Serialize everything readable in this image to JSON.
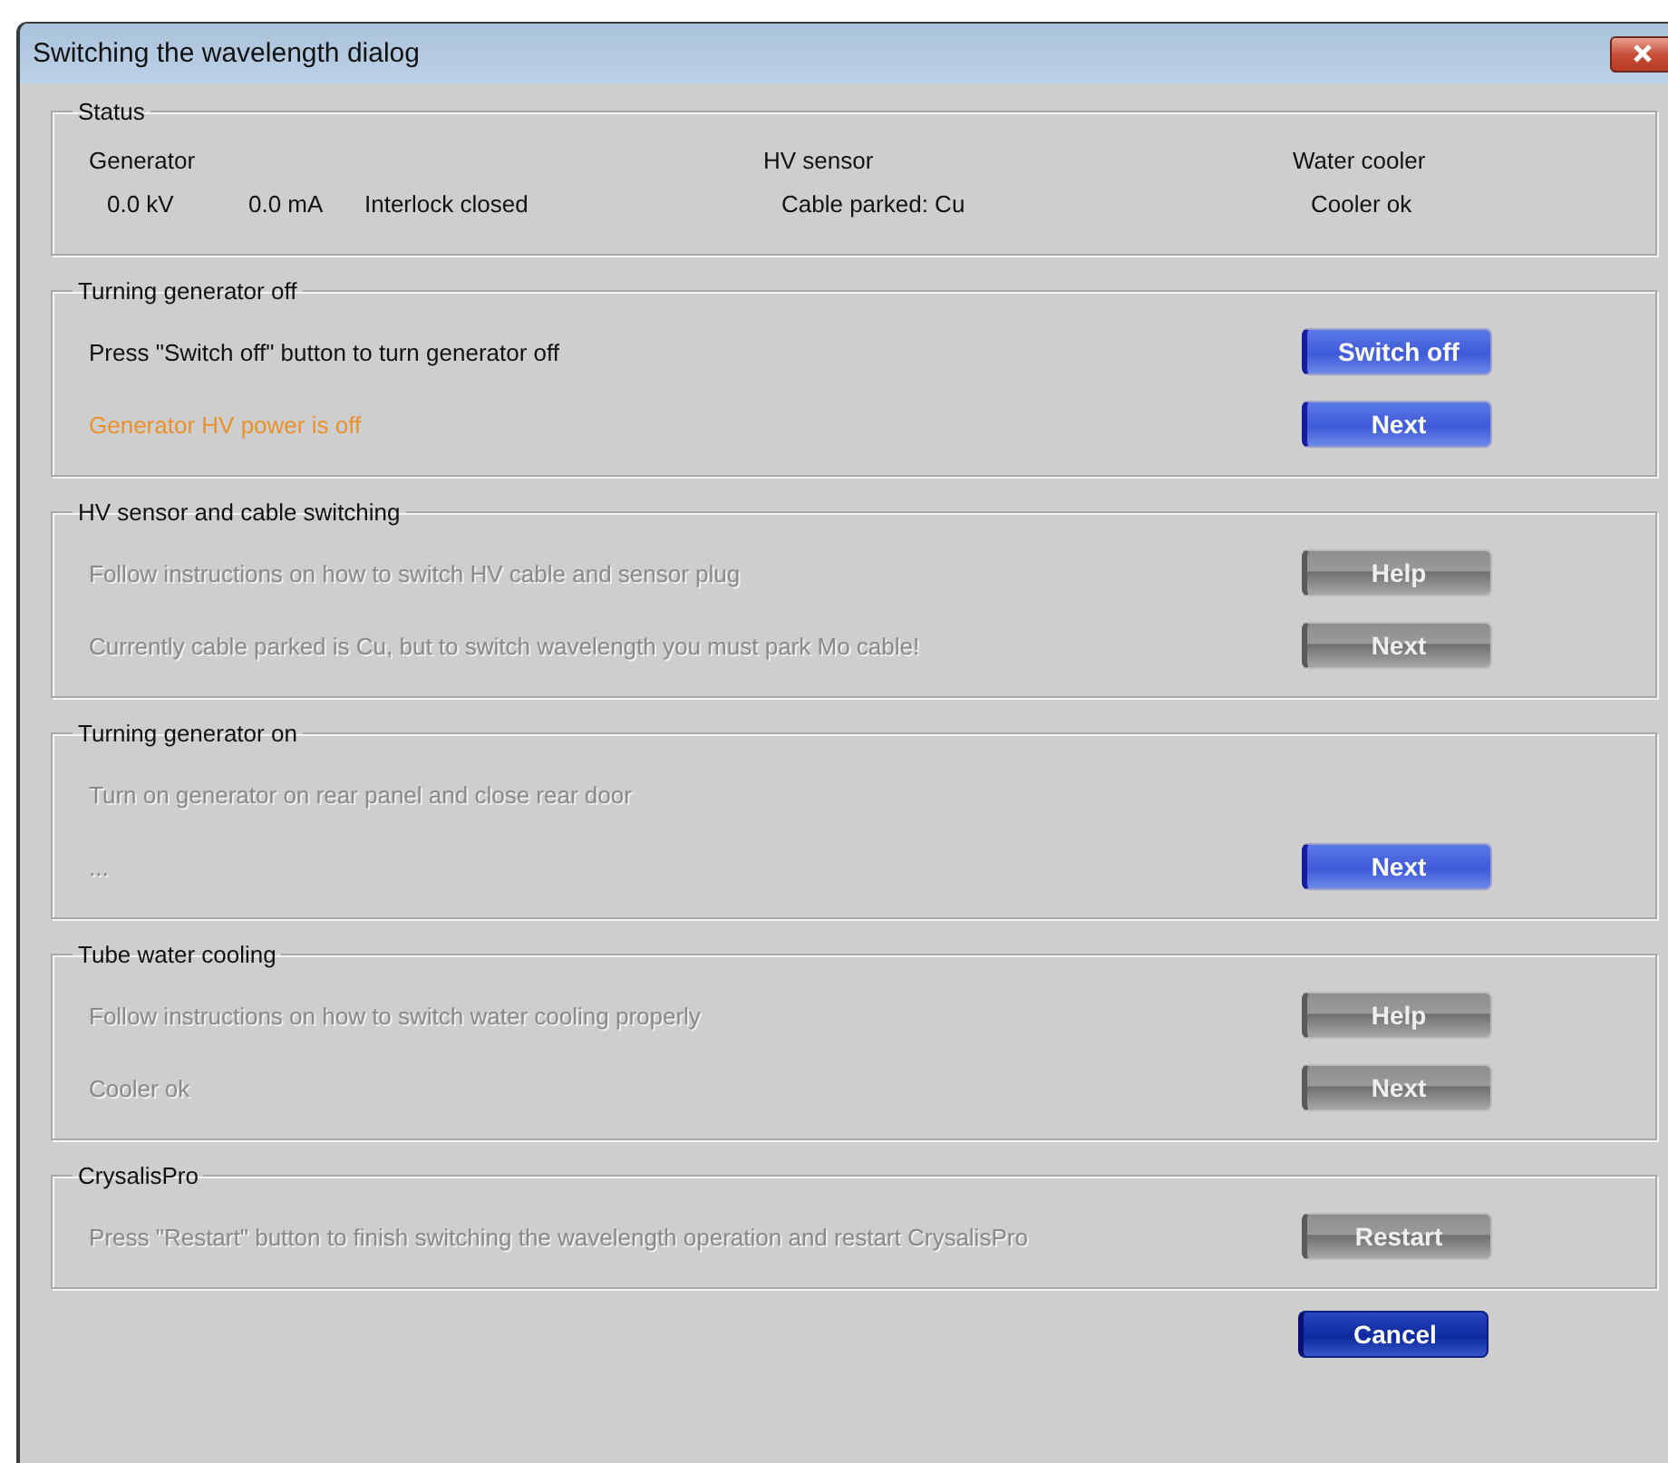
{
  "window": {
    "title": "Switching the wavelength dialog"
  },
  "status": {
    "title": "Status",
    "columns": [
      {
        "heading": "Generator",
        "values": [
          "0.0 kV",
          "0.0 mA",
          "Interlock closed"
        ]
      },
      {
        "heading": "HV sensor",
        "values": [
          "Cable parked: Cu"
        ]
      },
      {
        "heading": "Water cooler",
        "values": [
          "Cooler ok"
        ]
      }
    ]
  },
  "groups": [
    {
      "title": "Turning generator off",
      "rows": [
        {
          "text": "Press \"Switch off\" button to turn generator off",
          "kind": "instruction",
          "disabled": false,
          "button": {
            "label": "Switch off",
            "disabled": false
          }
        },
        {
          "text": "Generator HV power is off",
          "kind": "message",
          "disabled": false,
          "button": {
            "label": "Next",
            "disabled": false
          }
        }
      ]
    },
    {
      "title": "HV sensor and cable switching",
      "rows": [
        {
          "text": "Follow instructions on how to switch HV cable and sensor plug",
          "kind": "instruction",
          "disabled": true,
          "button": {
            "label": "Help",
            "disabled": true
          }
        },
        {
          "text": "Currently cable parked is Cu, but to switch wavelength you must park Mo cable!",
          "kind": "instruction",
          "disabled": true,
          "button": {
            "label": "Next",
            "disabled": true
          }
        }
      ]
    },
    {
      "title": "Turning generator on",
      "rows": [
        {
          "text": "Turn on generator on rear panel and close rear door",
          "kind": "instruction",
          "disabled": true
        },
        {
          "text": "...",
          "kind": "instruction",
          "disabled": true,
          "button": {
            "label": "Next",
            "disabled": false
          }
        }
      ]
    },
    {
      "title": "Tube water cooling",
      "rows": [
        {
          "text": "Follow instructions on how to switch water cooling properly",
          "kind": "instruction",
          "disabled": true,
          "button": {
            "label": "Help",
            "disabled": true
          }
        },
        {
          "text": "Cooler ok",
          "kind": "instruction",
          "disabled": true,
          "button": {
            "label": "Next",
            "disabled": true
          }
        }
      ]
    },
    {
      "title": "CrysalisPro",
      "rows": [
        {
          "text": "Press \"Restart\" button to finish switching the wavelength operation and restart CrysalisPro",
          "kind": "instruction",
          "disabled": true,
          "button": {
            "label": "Restart",
            "disabled": true
          }
        }
      ]
    }
  ],
  "footer": {
    "button": {
      "label": "Cancel",
      "default": true
    }
  }
}
